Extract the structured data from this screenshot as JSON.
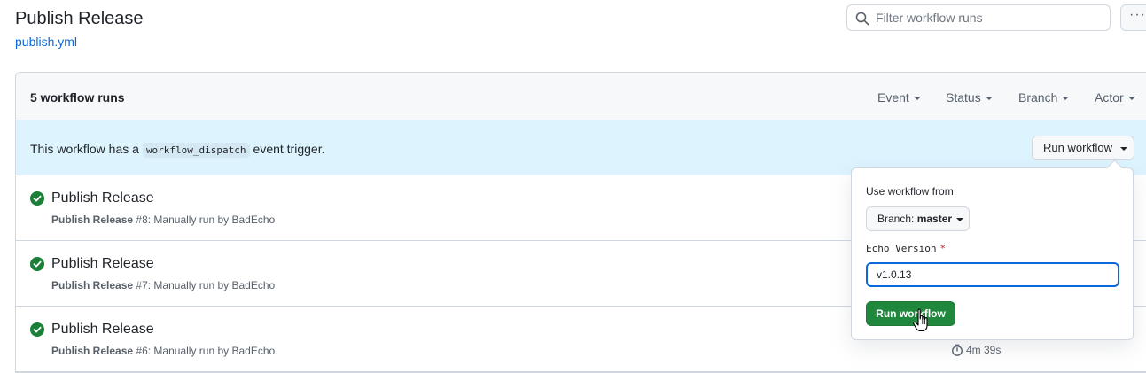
{
  "header": {
    "title": "Publish Release",
    "file_link": "publish.yml",
    "filter_placeholder": "Filter workflow runs",
    "more_label": "···"
  },
  "panel": {
    "runs_count": "5 workflow runs",
    "filters": [
      "Event",
      "Status",
      "Branch",
      "Actor"
    ]
  },
  "dispatch": {
    "text_before": "This workflow has a",
    "code": "workflow_dispatch",
    "text_after": "event trigger.",
    "button_label": "Run workflow"
  },
  "runs": [
    {
      "title": "Publish Release",
      "workflow": "Publish Release",
      "run_number": "#8",
      "detail": "Manually run by BadEcho",
      "status": "success"
    },
    {
      "title": "Publish Release",
      "workflow": "Publish Release",
      "run_number": "#7",
      "detail": "Manually run by BadEcho",
      "status": "success"
    },
    {
      "title": "Publish Release",
      "workflow": "Publish Release",
      "run_number": "#6",
      "detail": "Manually run by BadEcho",
      "status": "success"
    }
  ],
  "visible_duration": "4m 39s",
  "dropdown": {
    "use_from_label": "Use workflow from",
    "branch_prefix": "Branch:",
    "branch_name": "master",
    "input_label": "Echo Version",
    "required_mark": "*",
    "input_value": "v1.0.13",
    "submit_label": "Run workflow"
  },
  "colors": {
    "success": "#1a7f37",
    "link": "#0969da",
    "primary_button": "#1f883d",
    "info_banner": "#ddf4ff"
  }
}
